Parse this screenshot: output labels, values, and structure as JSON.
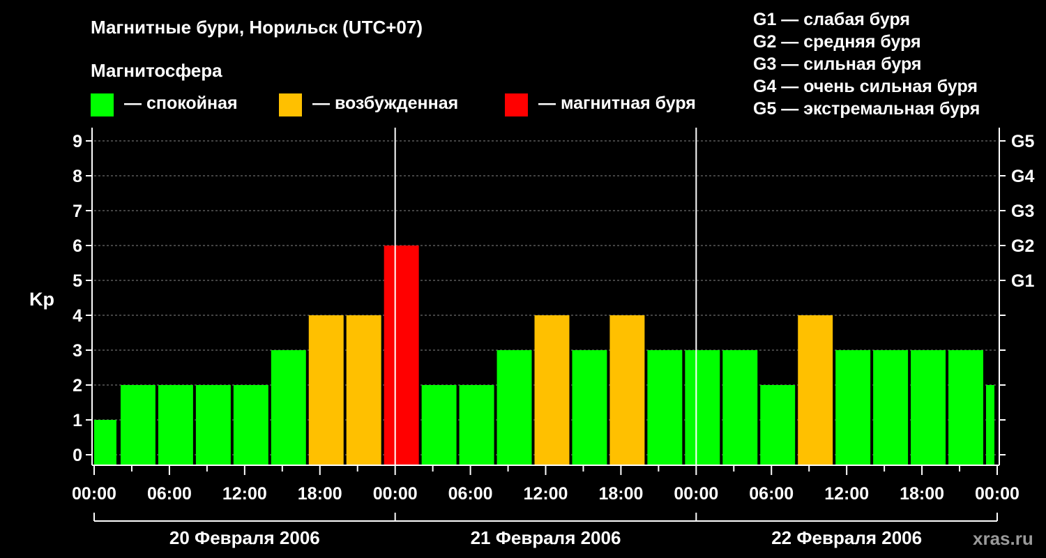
{
  "chart_data": {
    "type": "bar",
    "title": "Магнитные бури, Норильск (UTC+07)",
    "ylabel": "Kp",
    "ylim": [
      0,
      9
    ],
    "yticks": [
      "0",
      "1",
      "2",
      "3",
      "4",
      "5",
      "6",
      "7",
      "8",
      "9"
    ],
    "storm_scale_ticks": [
      {
        "kp": 5,
        "label": "G1"
      },
      {
        "kp": 6,
        "label": "G2"
      },
      {
        "kp": 7,
        "label": "G3"
      },
      {
        "kp": 8,
        "label": "G4"
      },
      {
        "kp": 9,
        "label": "G5"
      }
    ],
    "storm_scale_legend": [
      "G1 — слабая буря",
      "G2 — средняя буря",
      "G3 — сильная буря",
      "G4 — очень сильная буря",
      "G5 — экстремальная буря"
    ],
    "state_legend_title": "Магнитосфера",
    "state_legend": [
      {
        "label": "— спокойная",
        "color": "#00ff00"
      },
      {
        "label": "— возбужденная",
        "color": "#ffc000"
      },
      {
        "label": "— магнитная буря",
        "color": "#ff0000"
      }
    ],
    "x_tick_labels": [
      "00:00",
      "06:00",
      "12:00",
      "18:00",
      "00:00",
      "06:00",
      "12:00",
      "18:00",
      "00:00",
      "06:00",
      "12:00",
      "18:00",
      "00:00"
    ],
    "days": [
      "20 Февраля 2006",
      "21 Февраля 2006",
      "22 Февраля 2006"
    ],
    "bar_interval_hours": 3,
    "bars_start_hour": -1,
    "first_bar_visible_hours": 1,
    "values": [
      1,
      2,
      2,
      2,
      2,
      3,
      4,
      4,
      6,
      2,
      2,
      3,
      4,
      3,
      4,
      3,
      3,
      3,
      2,
      4,
      3,
      3,
      3,
      3,
      2
    ],
    "bar_colors": [
      "#00ff00",
      "#00ff00",
      "#00ff00",
      "#00ff00",
      "#00ff00",
      "#00ff00",
      "#ffc000",
      "#ffc000",
      "#ff0000",
      "#00ff00",
      "#00ff00",
      "#00ff00",
      "#ffc000",
      "#00ff00",
      "#ffc000",
      "#00ff00",
      "#00ff00",
      "#00ff00",
      "#00ff00",
      "#ffc000",
      "#00ff00",
      "#00ff00",
      "#00ff00",
      "#00ff00",
      "#00ff00"
    ],
    "grid": true
  },
  "watermark": "xras.ru"
}
